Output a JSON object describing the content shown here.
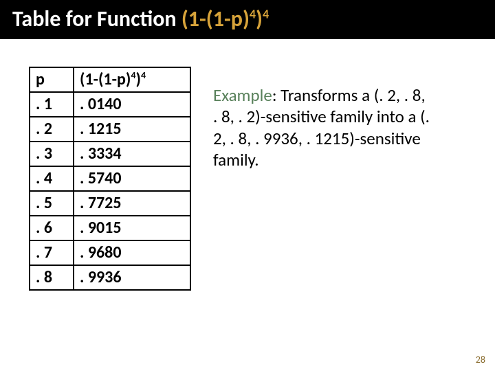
{
  "title": {
    "prefix": "Table for Function ",
    "expr_open": "(1-(1-p)",
    "sup1": "4",
    "expr_close": ")",
    "sup2": "4"
  },
  "table": {
    "header_p": "p",
    "header_expr_open": "(1-(1-p)",
    "header_sup1": "4",
    "header_expr_close": ")",
    "header_sup2": "4",
    "rows": [
      {
        "p": ". 1",
        "v": ". 0140"
      },
      {
        "p": ". 2",
        "v": ". 1215"
      },
      {
        "p": ". 3",
        "v": ". 3334"
      },
      {
        "p": ". 4",
        "v": ". 5740"
      },
      {
        "p": ". 5",
        "v": ". 7725"
      },
      {
        "p": ". 6",
        "v": ". 9015"
      },
      {
        "p": ". 7",
        "v": ". 9680"
      },
      {
        "p": ". 8",
        "v": ". 9936"
      }
    ]
  },
  "example": {
    "label": "Example",
    "text_1": ": Transforms a (. 2, . 8, . 8, . 2)-sensitive family into a",
    "text_2": "(. 2, . 8, . 9936, . 1215)-sensitive family."
  },
  "page_number": "28"
}
